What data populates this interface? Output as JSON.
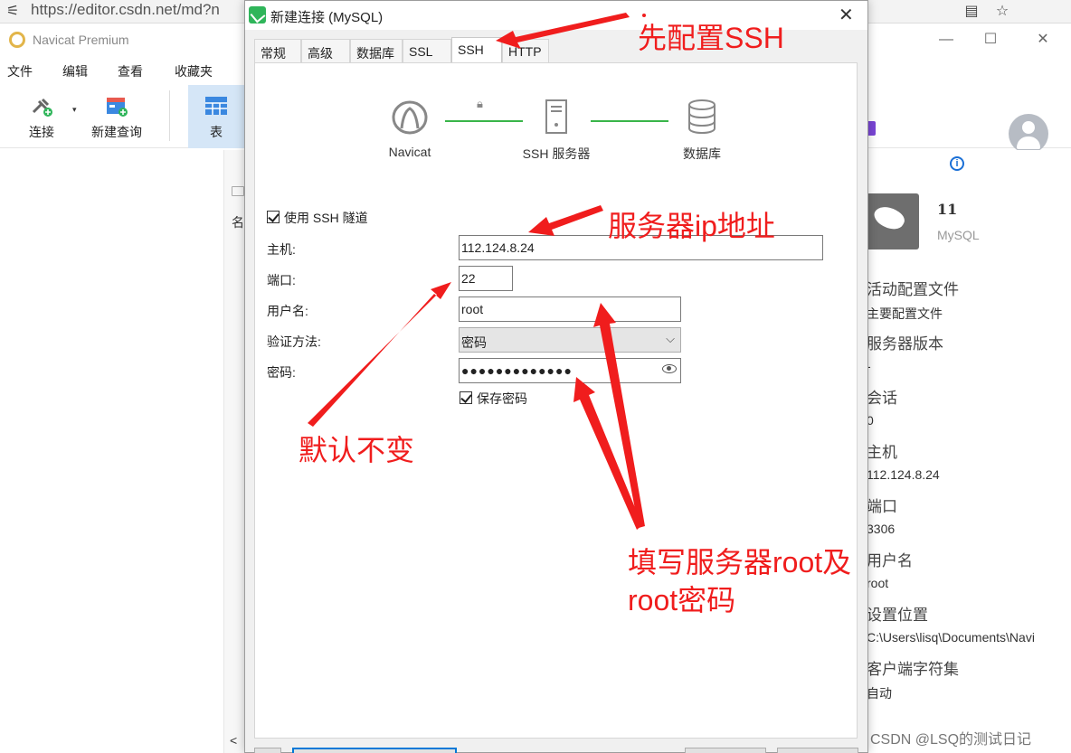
{
  "browser": {
    "url": "https://editor.csdn.net/md?n",
    "icons": [
      "tab-icon",
      "reader-icon",
      "favorite-star-icon"
    ]
  },
  "app": {
    "title": "Navicat Premium",
    "menu": [
      "文件",
      "编辑",
      "查看",
      "收藏夹"
    ],
    "toolbar": {
      "connect_label": "连接",
      "new_query_label": "新建查询",
      "table_label": "表",
      "right_label": "表"
    },
    "mid_header": "名",
    "mid_scroll": "<",
    "info": {
      "conn_name": "11",
      "conn_type": "MySQL",
      "props": [
        {
          "key": "活动配置文件",
          "value": "主要配置文件"
        },
        {
          "key": "服务器版本",
          "value": "-"
        },
        {
          "key": "会话",
          "value": "0"
        },
        {
          "key": "主机",
          "value": "112.124.8.24"
        },
        {
          "key": "端口",
          "value": "3306"
        },
        {
          "key": "用户名",
          "value": "root"
        },
        {
          "key": "设置位置",
          "value": "C:\\Users\\lisq\\Documents\\Navi"
        },
        {
          "key": "客户端字符集",
          "value": "自动"
        }
      ]
    },
    "watermark": "CSDN @LSQ的测试日记"
  },
  "dialog": {
    "title": "新建连接 (MySQL)",
    "tabs": [
      "常规",
      "高级",
      "数据库",
      "SSL",
      "SSH",
      "HTTP"
    ],
    "active_tab": "SSH",
    "diagram": {
      "nodes": [
        "Navicat",
        "SSH 服务器",
        "数据库"
      ],
      "link_color": "#39b54a"
    },
    "form": {
      "use_ssh_label": "使用 SSH 隧道",
      "use_ssh_checked": true,
      "host_label": "主机:",
      "host_value": "112.124.8.24",
      "port_label": "端口:",
      "port_value": "22",
      "user_label": "用户名:",
      "user_value": "root",
      "auth_label": "验证方法:",
      "auth_value": "密码",
      "password_label": "密码:",
      "password_value": "●●●●●●●●●●●●●",
      "save_password_label": "保存密码",
      "save_password_checked": true
    }
  },
  "annotations": {
    "color": "#f01d1d",
    "configure_ssh": "先配置SSH",
    "server_ip": "服务器ip地址",
    "default_unchanged": "默认不变",
    "fill_root_line1": "填写服务器root及",
    "fill_root_line2": "root密码"
  }
}
